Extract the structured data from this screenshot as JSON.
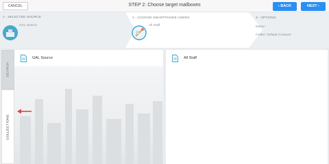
{
  "toolbar": {
    "cancel_label": "CANCEL",
    "title": "STEP 2: Choose target mailboxes",
    "back_label": "BACK",
    "next_label": "NEXT"
  },
  "steps": [
    {
      "label": "1 - SELECTED SOURCE",
      "detail": "GAL Source"
    },
    {
      "label": "2 - CHOOSE SMARTPHONE USERS",
      "detail": "All Staff"
    },
    {
      "label": "3 - OPTIONS",
      "detail_line1": "Name:",
      "detail_line2": "Folder: Default Contacts"
    }
  ],
  "side_tabs": [
    {
      "label": "SEARCH"
    },
    {
      "label": "COLLECTIONS"
    }
  ],
  "left_panel": {
    "title": "GAL Source"
  },
  "right_panel": {
    "title": "All Staff"
  },
  "colors": {
    "accent": "#2a8ff2",
    "pointer_arrow": "#e0443a"
  }
}
